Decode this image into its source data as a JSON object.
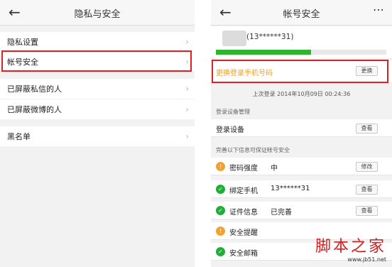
{
  "left": {
    "title": "隐私与安全",
    "items": [
      {
        "label": "隐私设置"
      },
      {
        "label": "帐号安全"
      },
      {
        "label": "已屏蔽私信的人"
      },
      {
        "label": "已屏蔽微博的人"
      },
      {
        "label": "黑名单"
      }
    ]
  },
  "right": {
    "title": "帐号安全",
    "account_number": "(13******31)",
    "progress": 0.56,
    "change_phone_label": "更换登录手机号码",
    "change_button": "更换",
    "last_login": "上次登录 2014年10月09日 00:24:36",
    "login_mgmt_header": "登录设备管理",
    "login_device_label": "登录设备",
    "view_button": "查看",
    "complete_info_header": "完善以下信息可保证帐号安全",
    "security_rows": [
      {
        "label": "密码强度",
        "value": "中",
        "status": "warning",
        "button": "修改"
      },
      {
        "label": "绑定手机",
        "value": "13******31",
        "status": "ok",
        "button": "查看"
      },
      {
        "label": "证件信息",
        "value": "已完善",
        "status": "ok",
        "button": "查看"
      },
      {
        "label": "安全提醒",
        "value": "",
        "status": "warning",
        "button": ""
      },
      {
        "label": "安全邮箱",
        "value": "",
        "status": "ok",
        "button": ""
      }
    ],
    "colors": {
      "warning": "#f3a231",
      "ok": "#21ad37",
      "highlight": "#e02020"
    }
  },
  "watermark": {
    "big": "脚本之家",
    "small": "www.jb51.net"
  }
}
